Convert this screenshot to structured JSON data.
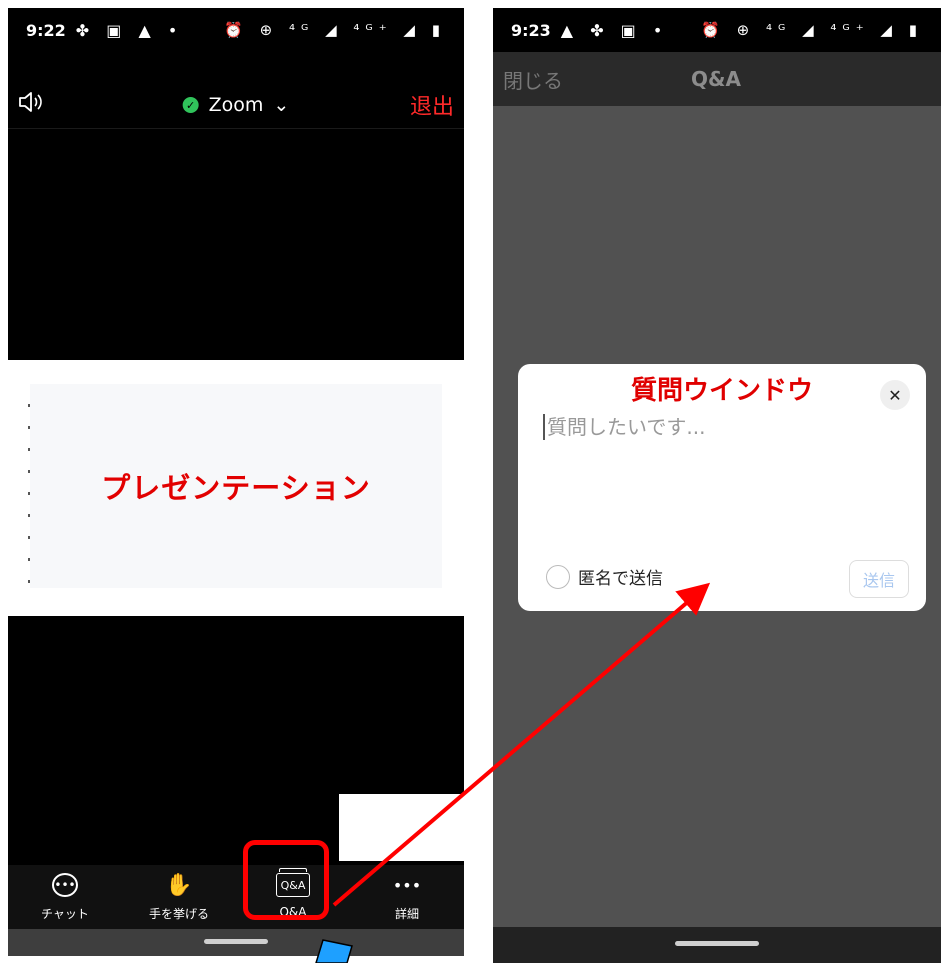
{
  "left": {
    "status": {
      "time": "9:22",
      "icons_left": "✤ ▣ ▲ •",
      "icons_right": "⏰ ⊕ ⁴ᴳ ◢ ⁴ᴳ⁺ ◢ ▮"
    },
    "topbar": {
      "speaker_icon": "speaker-icon",
      "title": "Zoom",
      "chevron": "⌄",
      "leave_label": "退出"
    },
    "presentation_label": "プレゼンテーション",
    "toolbar": [
      {
        "label": "チャット",
        "icon": "chat-icon"
      },
      {
        "label": "手を挙げる",
        "icon": "raise-hand-icon",
        "glyph": "✋"
      },
      {
        "label": "Q&A",
        "icon": "qa-icon",
        "glyph": "Q&A"
      },
      {
        "label": "詳細",
        "icon": "more-icon",
        "glyph": "•••"
      }
    ],
    "chat_glyph": "•••"
  },
  "right": {
    "status": {
      "time": "9:23",
      "icons_left": "▲ ✤ ▣ •",
      "icons_right": "⏰ ⊕ ⁴ᴳ ◢ ⁴ᴳ⁺ ◢ ▮"
    },
    "header": {
      "close_label": "閉じる",
      "title": "Q&A"
    },
    "dialog": {
      "title": "質問ウインドウ",
      "close_glyph": "✕",
      "placeholder": "質問したいです...",
      "anonymous_label": "匿名で送信",
      "send_label": "送信"
    }
  },
  "colors": {
    "annotation_red": "#ff0000",
    "arrow_blue": "#1ea0ff"
  }
}
